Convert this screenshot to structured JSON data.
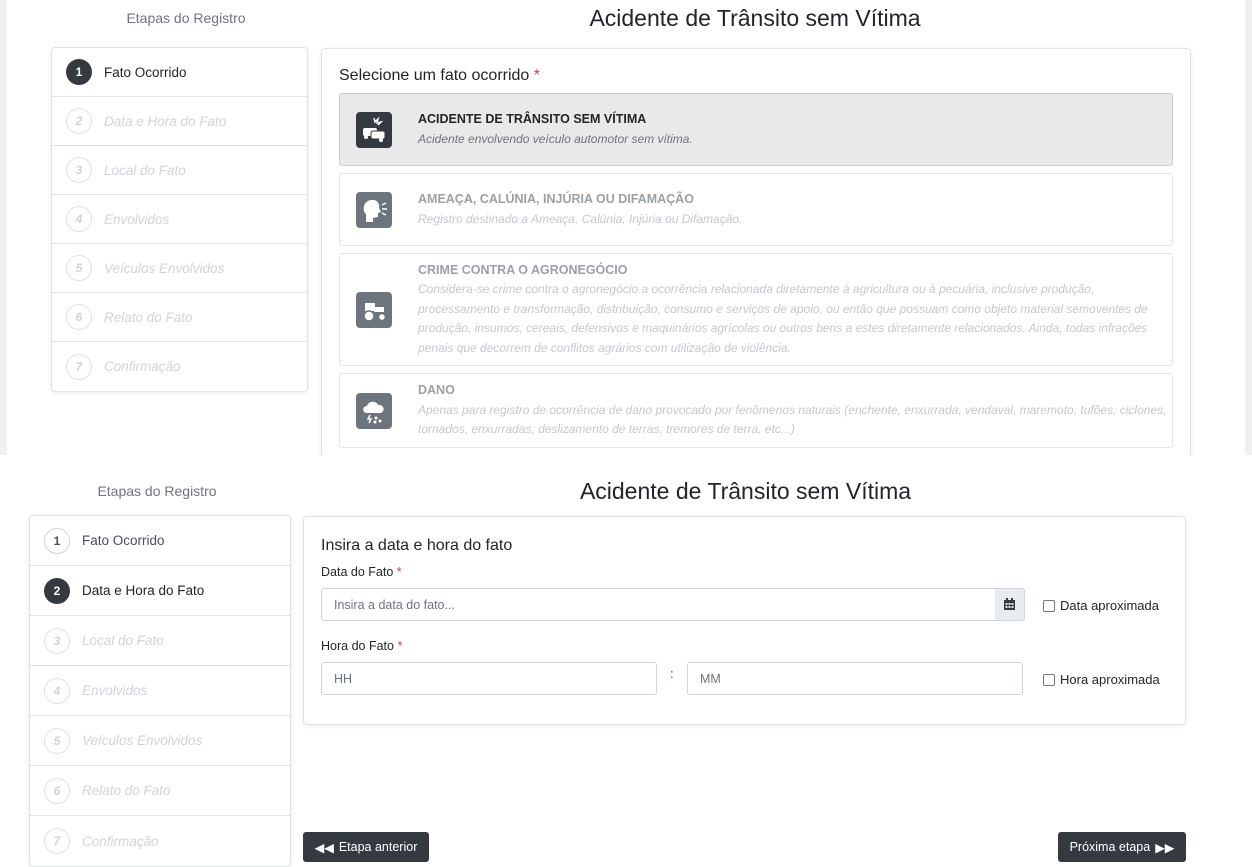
{
  "screen1": {
    "steps_title": "Etapas do Registro",
    "main_title": "Acidente de Trânsito sem Vítima",
    "steps": [
      {
        "num": "1",
        "label": "Fato Ocorrido"
      },
      {
        "num": "2",
        "label": "Data e Hora do Fato"
      },
      {
        "num": "3",
        "label": "Local do Fato"
      },
      {
        "num": "4",
        "label": "Envolvidos"
      },
      {
        "num": "5",
        "label": "Veículos Envolvidos"
      },
      {
        "num": "6",
        "label": "Relato do Fato"
      },
      {
        "num": "7",
        "label": "Confirmação"
      }
    ],
    "card_title": "Selecione um fato ocorrido",
    "required_mark": "*",
    "options": [
      {
        "title": "ACIDENTE DE TRÂNSITO SEM VÍTIMA",
        "desc": "Acidente envolvendo veículo automotor sem vítima.",
        "icon": "car-crash-icon",
        "selected": true
      },
      {
        "title": "AMEAÇA, CALÚNIA, INJÚRIA OU DIFAMAÇÃO",
        "desc": "Registro destinado a Ameaça, Calúnia, Injúria ou Difamação.",
        "icon": "speaking-head-icon",
        "selected": false
      },
      {
        "title": "CRIME CONTRA O AGRONEGÓCIO",
        "desc": "Considera-se crime contra o agronegócio a ocorrência relacionada diretamente à agricultura ou à pecuária, inclusive produção, processamento e transformação, distribuição, consumo e serviços de apoio, ou então que possuam como objeto material semoventes de produção, insumos, cereais, defensivos e maquinários agrícolas ou outros bens a estes diretamente relacionados. Ainda, todas infrações penais que decorrem de conflitos agrários com utilização de violência.",
        "icon": "tractor-icon",
        "selected": false
      },
      {
        "title": "DANO",
        "desc": "Apenas para registro de ocorrência de dano provocado por fenômenos naturais (enchente, enxurrada, vendaval, maremoto, tufões, ciclones, tornados, enxurradas, deslizamento de terras, tremores de terra, etc...)",
        "icon": "storm-cloud-icon",
        "selected": false
      }
    ]
  },
  "screen2": {
    "steps_title": "Etapas do Registro",
    "main_title": "Acidente de Trânsito sem Vítima",
    "steps": [
      {
        "num": "1",
        "label": "Fato Ocorrido"
      },
      {
        "num": "2",
        "label": "Data e Hora do Fato"
      },
      {
        "num": "3",
        "label": "Local do Fato"
      },
      {
        "num": "4",
        "label": "Envolvidos"
      },
      {
        "num": "5",
        "label": "Veículos Envolvidos"
      },
      {
        "num": "6",
        "label": "Relato do Fato"
      },
      {
        "num": "7",
        "label": "Confirmação"
      }
    ],
    "card_title": "Insira a data e hora do fato",
    "date_label": "Data do Fato",
    "date_placeholder": "Insira a data do fato...",
    "date_approx": "Data aproximada",
    "time_label": "Hora do Fato",
    "hour_placeholder": "HH",
    "minute_placeholder": "MM",
    "colon": ":",
    "time_approx": "Hora aproximada",
    "required_mark": "*",
    "prev_button": "Etapa anterior",
    "next_button": "Próxima etapa"
  }
}
